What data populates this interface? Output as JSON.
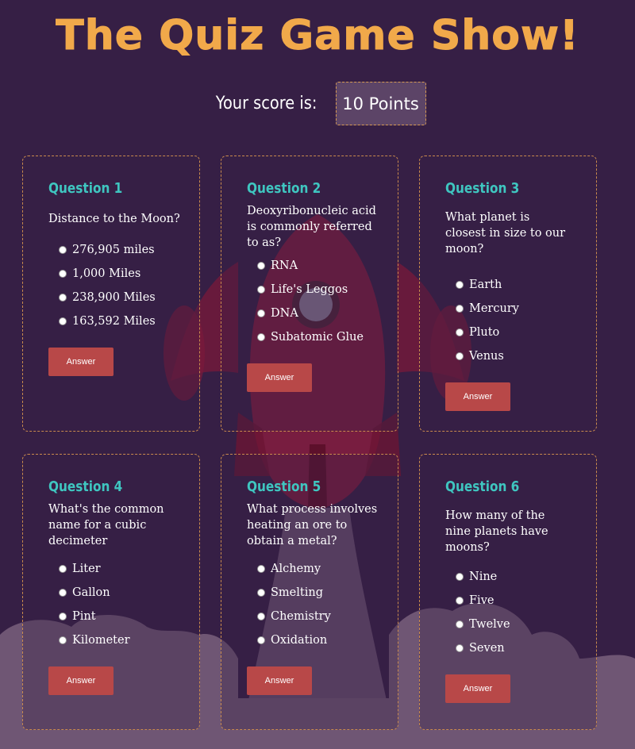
{
  "header": {
    "title": "The Quiz Game Show!",
    "score_label": "Your score is:",
    "score_value": "10 Points"
  },
  "colors": {
    "background": "#361f45",
    "title": "#f1a94a",
    "question_heading": "#3fc6c0",
    "button": "#b84848",
    "card_border": "#c98a4d"
  },
  "questions": [
    {
      "heading": "Question 1",
      "text": "Distance to the Moon?",
      "options": [
        "276,905 miles",
        "1,000 Miles",
        "238,900 Miles",
        "163,592 Miles"
      ],
      "button": "Answer"
    },
    {
      "heading": "Question 2",
      "text": "Deoxyribonucleic acid is commonly referred to as?",
      "options": [
        "RNA",
        "Life's Leggos",
        "DNA",
        "Subatomic Glue"
      ],
      "button": "Answer"
    },
    {
      "heading": "Question 3",
      "text": "What planet is closest in size to our moon?",
      "options": [
        "Earth",
        "Mercury",
        "Pluto",
        "Venus"
      ],
      "button": "Answer"
    },
    {
      "heading": "Question 4",
      "text": "What's the common name for a cubic decimeter",
      "options": [
        "Liter",
        "Gallon",
        "Pint",
        "Kilometer"
      ],
      "button": "Answer"
    },
    {
      "heading": "Question 5",
      "text": "What process involves heating an ore to obtain a metal?",
      "options": [
        "Alchemy",
        "Smelting",
        "Chemistry",
        "Oxidation"
      ],
      "button": "Answer"
    },
    {
      "heading": "Question 6",
      "text": "How many of the nine planets have moons?",
      "options": [
        "Nine",
        "Five",
        "Twelve",
        "Seven"
      ],
      "button": "Answer"
    }
  ]
}
